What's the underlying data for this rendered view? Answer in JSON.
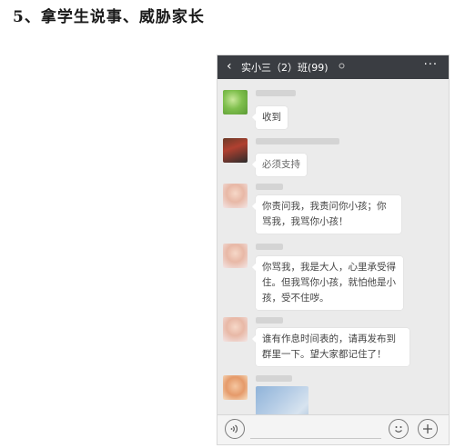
{
  "heading": "5、拿学生说事、威胁家长",
  "chat": {
    "back_icon": "‹",
    "title": "实小三（2）班(99)",
    "more_icon": "···",
    "messages": [
      {
        "text": "收到"
      },
      {
        "text": "必须支持"
      },
      {
        "text": "你责问我，我责问你小孩；你骂我，我骂你小孩！"
      },
      {
        "text": "你骂我，我是大人，心里承受得住。但我骂你小孩，就怕他是小孩，受不住哕。"
      },
      {
        "text": "谁有作息时间表的，请再发布到群里一下。望大家都记住了！"
      }
    ]
  },
  "input_bar": {
    "voice_icon": "voice-icon",
    "emoji_icon": "emoji-icon",
    "plus_icon": "plus-icon"
  }
}
